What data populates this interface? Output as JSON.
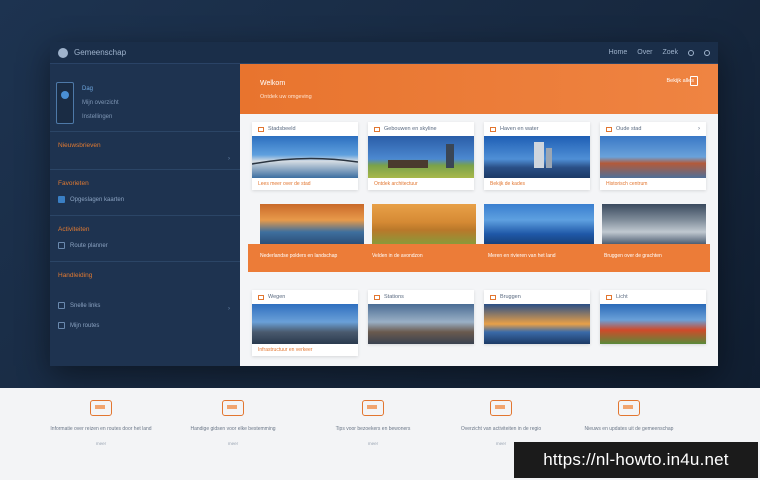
{
  "window": {
    "title": "Gemeenschap",
    "controls": [
      "Home",
      "Over",
      "Zoek"
    ]
  },
  "sidebar": {
    "profile_lines": [
      "Dag",
      "Mijn overzicht",
      "Instellingen"
    ],
    "sections": [
      {
        "label": "Nieuwsbrieven",
        "rows": []
      },
      {
        "label": "Favorieten",
        "rows": [
          "Opgeslagen kaarten"
        ]
      },
      {
        "label": "Activiteiten",
        "rows": [
          "Route planner"
        ]
      },
      {
        "label": "Handleiding",
        "rows": [
          "Snelle links",
          "Mijn routes"
        ]
      }
    ]
  },
  "banner": {
    "title": "Welkom",
    "subtitle": "Ontdek uw omgeving",
    "right": "Bekijk alles"
  },
  "cards_top": [
    {
      "head": "Stadsbeeld",
      "foot": "Lees meer over de stad"
    },
    {
      "head": "Gebouwen en skyline",
      "foot": "Ontdek architectuur"
    },
    {
      "head": "Haven en water",
      "foot": "Bekijk de kades"
    },
    {
      "head": "Oude stad",
      "foot": "Historisch centrum"
    }
  ],
  "strip_texts": [
    "Nederlandse polders en landschap",
    "Velden in de avondzon",
    "Meren en rivieren van het land",
    "Bruggen over de grachten"
  ],
  "cards_bottom": [
    {
      "head": "Wegen",
      "foot": "Infrastructuur en verkeer"
    },
    {
      "head": "Stations",
      "foot": ""
    },
    {
      "head": "Bruggen",
      "foot": ""
    },
    {
      "head": "Licht",
      "foot": ""
    }
  ],
  "footer_cols": [
    {
      "text": "Informatie over reizen en routes door het land",
      "sub": "meer"
    },
    {
      "text": "Handige gidsen voor elke bestemming",
      "sub": "meer"
    },
    {
      "text": "Tips voor bezoekers en bewoners",
      "sub": "meer"
    },
    {
      "text": "Overzicht van activiteiten in de regio",
      "sub": "meer"
    },
    {
      "text": "Nieuws en updates uit de gemeenschap",
      "sub": "meer"
    }
  ],
  "url_badge": "https://nl-howto.in4u.net",
  "colors": {
    "accent": "#e8742e",
    "sidebar": "#1e3350",
    "content": "#f4f5f7"
  }
}
